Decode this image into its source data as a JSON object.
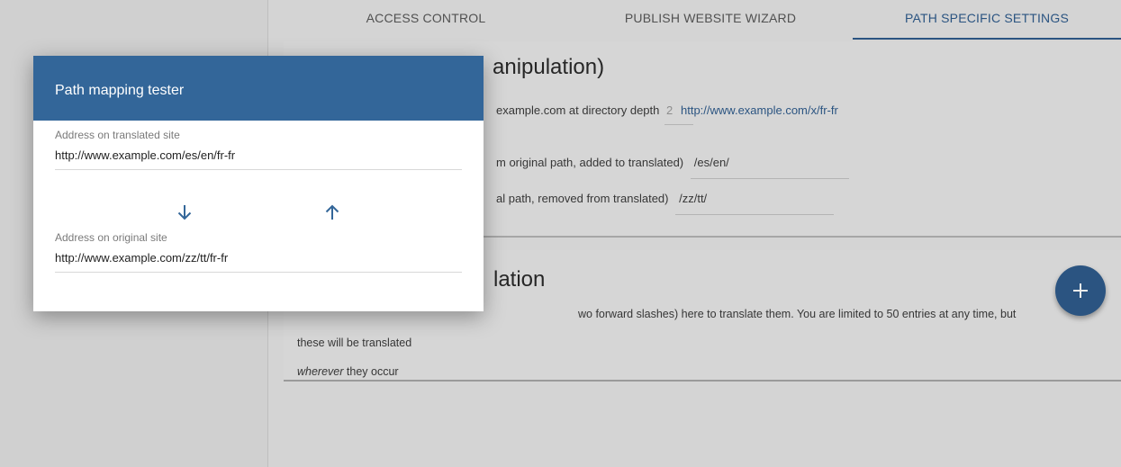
{
  "tabs": [
    {
      "label": "ACCESS CONTROL"
    },
    {
      "label": "PUBLISH WEBSITE WIZARD"
    },
    {
      "label": "PATH SPECIFIC SETTINGS"
    }
  ],
  "path_settings": {
    "title_visible": "anipulation)",
    "depth_text": "example.com at directory depth",
    "depth_value": "2",
    "depth_link": "http://www.example.com/x/fr-fr",
    "lang_text": "m original path, added to translated)",
    "lang_value": "/es/en/",
    "trunc_text": "al path, removed from translated)",
    "trunc_value": "/zz/tt/"
  },
  "translation": {
    "title_visible": "lation",
    "desc_visible": "wo forward slashes) here to translate them. You are limited to 50 entries at any time, but these will be translated",
    "desc_em": "wherever",
    "desc_tail": " they occur",
    "fab_icon": "plus-icon"
  },
  "dialog": {
    "title": "Path mapping tester",
    "translated_label": "Address on translated site",
    "translated_value": "http://www.example.com/es/en/fr-fr",
    "original_label": "Address on original site",
    "original_value": "http://www.example.com/zz/tt/fr-fr",
    "down_icon": "arrow-down-icon",
    "up_icon": "arrow-up-icon"
  },
  "colors": {
    "accent": "#336699",
    "tab_active": "#2f5c8d",
    "link": "#2f5c8d"
  }
}
